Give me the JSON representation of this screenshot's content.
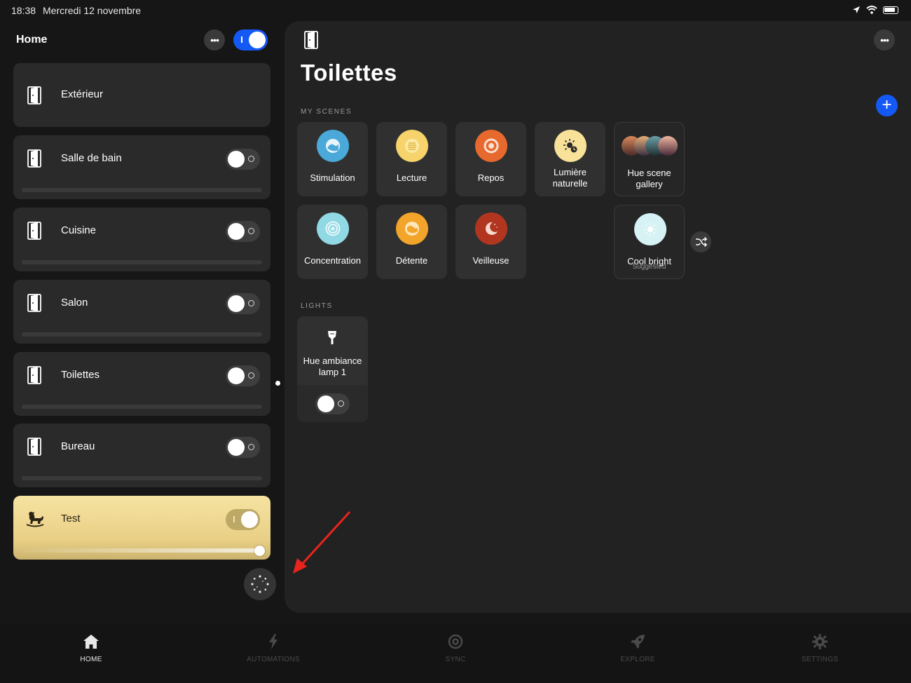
{
  "status_bar": {
    "time": "18:38",
    "date": "Mercredi 12 novembre"
  },
  "sidebar": {
    "title": "Home",
    "rooms": [
      {
        "name": "Extérieur",
        "has_toggle": false
      },
      {
        "name": "Salle de bain",
        "has_toggle": true,
        "on": false
      },
      {
        "name": "Cuisine",
        "has_toggle": true,
        "on": false
      },
      {
        "name": "Salon",
        "has_toggle": true,
        "on": false
      },
      {
        "name": "Toilettes",
        "has_toggle": true,
        "on": false
      },
      {
        "name": "Bureau",
        "has_toggle": true,
        "on": false
      },
      {
        "name": "Test",
        "has_toggle": true,
        "on": true,
        "brightness": 1.0,
        "icon": "rocking-horse-icon"
      }
    ]
  },
  "main": {
    "title": "Toilettes",
    "sections": {
      "scenes": "MY SCENES",
      "lights": "LIGHTS"
    },
    "scenes": [
      {
        "name": "Stimulation",
        "color": "#4aa9d8"
      },
      {
        "name": "Lecture",
        "color": "#f6d36b"
      },
      {
        "name": "Repos",
        "color": "#e8692e"
      },
      {
        "name_line1": "Lumière",
        "name_line2": "naturelle",
        "color": "#f8e29a"
      },
      {
        "name_line1": "Hue scene",
        "name_line2": "gallery"
      },
      {
        "name": "Concentration",
        "color": "#8fd8e4"
      },
      {
        "name": "Détente",
        "color": "#f3a42a"
      },
      {
        "name": "Veilleuse",
        "color": "#b2361f"
      },
      {
        "name": "Cool bright",
        "suggested_label": "Suggested",
        "color": "#d6f2f4"
      }
    ],
    "lights": [
      {
        "name_line1": "Hue ambiance",
        "name_line2": "lamp 1",
        "on": false
      }
    ]
  },
  "tabs": [
    {
      "label": "HOME",
      "icon": "home-icon",
      "active": true
    },
    {
      "label": "AUTOMATIONS",
      "icon": "lightning-icon",
      "active": false
    },
    {
      "label": "SYNC",
      "icon": "sync-icon",
      "active": false
    },
    {
      "label": "EXPLORE",
      "icon": "rocket-icon",
      "active": false
    },
    {
      "label": "SETTINGS",
      "icon": "gear-icon",
      "active": false
    }
  ],
  "colors": {
    "accent": "#1559f5",
    "panel": "#222222",
    "card": "#2a2a2a",
    "annotation": "#e8241c"
  }
}
